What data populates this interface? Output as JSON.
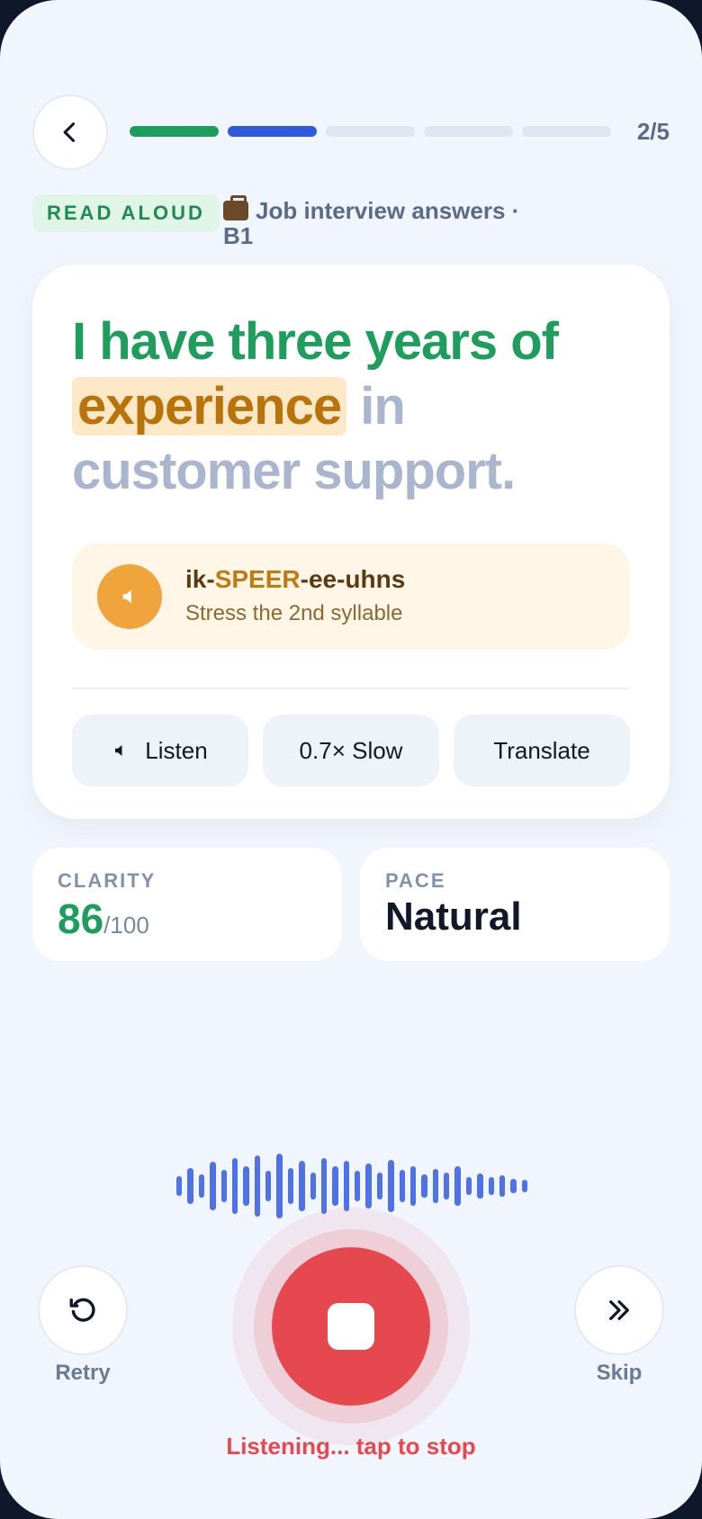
{
  "header": {
    "step_count": "2/5",
    "progress": {
      "total": 5,
      "current": 2,
      "completed": 1
    }
  },
  "tag": {
    "label": "READ ALOUD"
  },
  "topic": {
    "icon": "briefcase-icon",
    "text": "Job interview answers · B1"
  },
  "sentence": {
    "read": "I have three years of ",
    "active": "experience",
    "pending": " in customer support."
  },
  "pronunciation": {
    "pre": "ik-",
    "stress": "SPEER",
    "post": "-ee-uhns",
    "hint": "Stress the 2nd syllable"
  },
  "actions": {
    "listen": "Listen",
    "slow": "0.7× Slow",
    "translate": "Translate"
  },
  "stats": {
    "clarity": {
      "label": "CLARITY",
      "value": "86",
      "max": "/100"
    },
    "pace": {
      "label": "PACE",
      "value": "Natural"
    }
  },
  "controls": {
    "retry": "Retry",
    "skip": "Skip"
  },
  "status": "Listening... tap to stop",
  "colors": {
    "accent_green": "#1f9d5c",
    "accent_blue": "#2f5bdb",
    "record_red": "#e5484f",
    "stress_orange": "#c07a10"
  }
}
